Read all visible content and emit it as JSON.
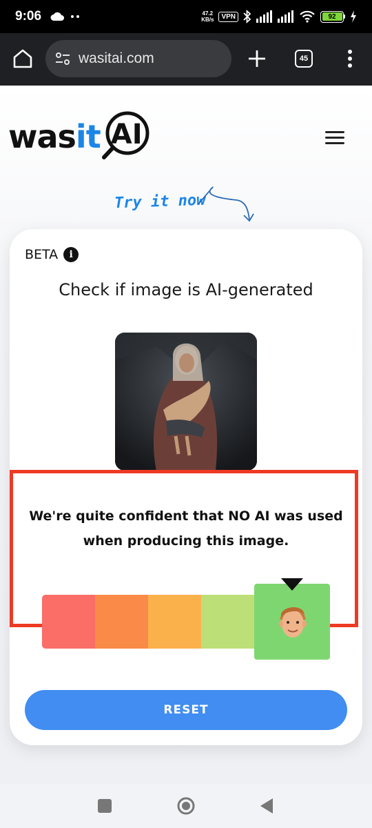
{
  "status_bar": {
    "time": "9:06",
    "net_speed_top": "47.2",
    "net_speed_bottom": "KB/s",
    "vpn": "VPN",
    "battery": "92"
  },
  "browser": {
    "url": "wasitai.com",
    "tab_count": "45"
  },
  "site": {
    "logo_was": "was",
    "logo_it": "it",
    "logo_ai": "AI",
    "try_it": "Try it now"
  },
  "card": {
    "beta_label": "BETA",
    "title": "Check if image is AI-generated",
    "result_line1": "We're quite confident that NO AI was used",
    "result_line2": "when producing this image.",
    "reset_label": "RESET"
  },
  "colors": {
    "accent": "#1b86e8",
    "reset_button": "#418df1",
    "highlight_border": "#ee3a22",
    "scale": [
      "#fb6d67",
      "#fa8a48",
      "#fbb14b",
      "#bddf78",
      "#7ed671"
    ]
  },
  "confidence_scale": {
    "levels": 5,
    "selected_level": 5
  }
}
